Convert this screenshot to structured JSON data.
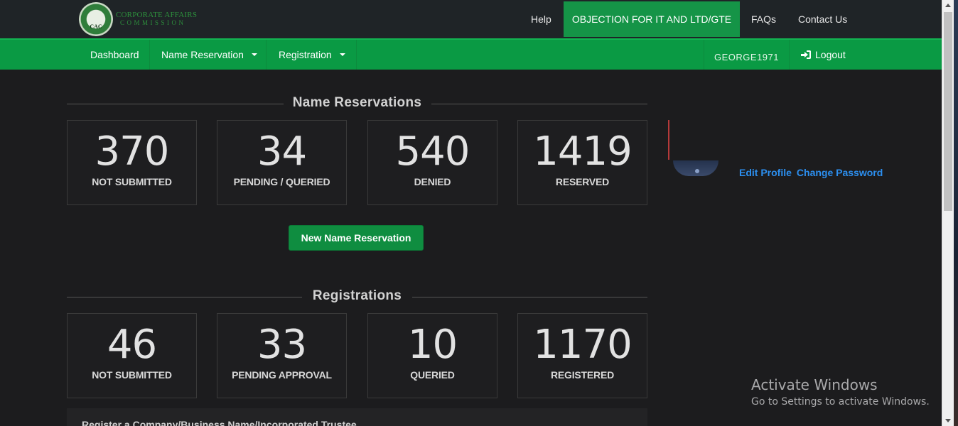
{
  "brand": {
    "seal_text": "CAC",
    "name_line1": "CORPORATE AFFAIRS",
    "name_line2": "COMMISSION"
  },
  "topnav": {
    "help": "Help",
    "objection": "OBJECTION FOR IT AND LTD/GTE",
    "faqs": "FAQs",
    "contact": "Contact Us"
  },
  "mainnav": {
    "dashboard": "Dashboard",
    "name_reservation": "Name Reservation",
    "registration": "Registration",
    "user": "GEORGE1971",
    "logout": "Logout"
  },
  "name_reservations": {
    "title": "Name Reservations",
    "cards": [
      {
        "value": "370",
        "label": "NOT SUBMITTED"
      },
      {
        "value": "34",
        "label": "PENDING / QUERIED"
      },
      {
        "value": "540",
        "label": "DENIED"
      },
      {
        "value": "1419",
        "label": "RESERVED"
      }
    ],
    "button": "New Name Reservation"
  },
  "registrations": {
    "title": "Registrations",
    "cards": [
      {
        "value": "46",
        "label": "NOT SUBMITTED"
      },
      {
        "value": "33",
        "label": "PENDING APPROVAL"
      },
      {
        "value": "10",
        "label": "QUERIED"
      },
      {
        "value": "1170",
        "label": "REGISTERED"
      }
    ]
  },
  "profile": {
    "edit": "Edit Profile",
    "change_password": "Change Password"
  },
  "bottom_panel": {
    "title": "Register a Company/Business Name/Incorporated Trustee"
  },
  "watermark": {
    "line1": "Activate Windows",
    "line2": "Go to Settings to activate Windows."
  },
  "colors": {
    "accent_green": "#0a9a44",
    "link_blue": "#2c8ff0",
    "background": "#1c1c1e"
  }
}
